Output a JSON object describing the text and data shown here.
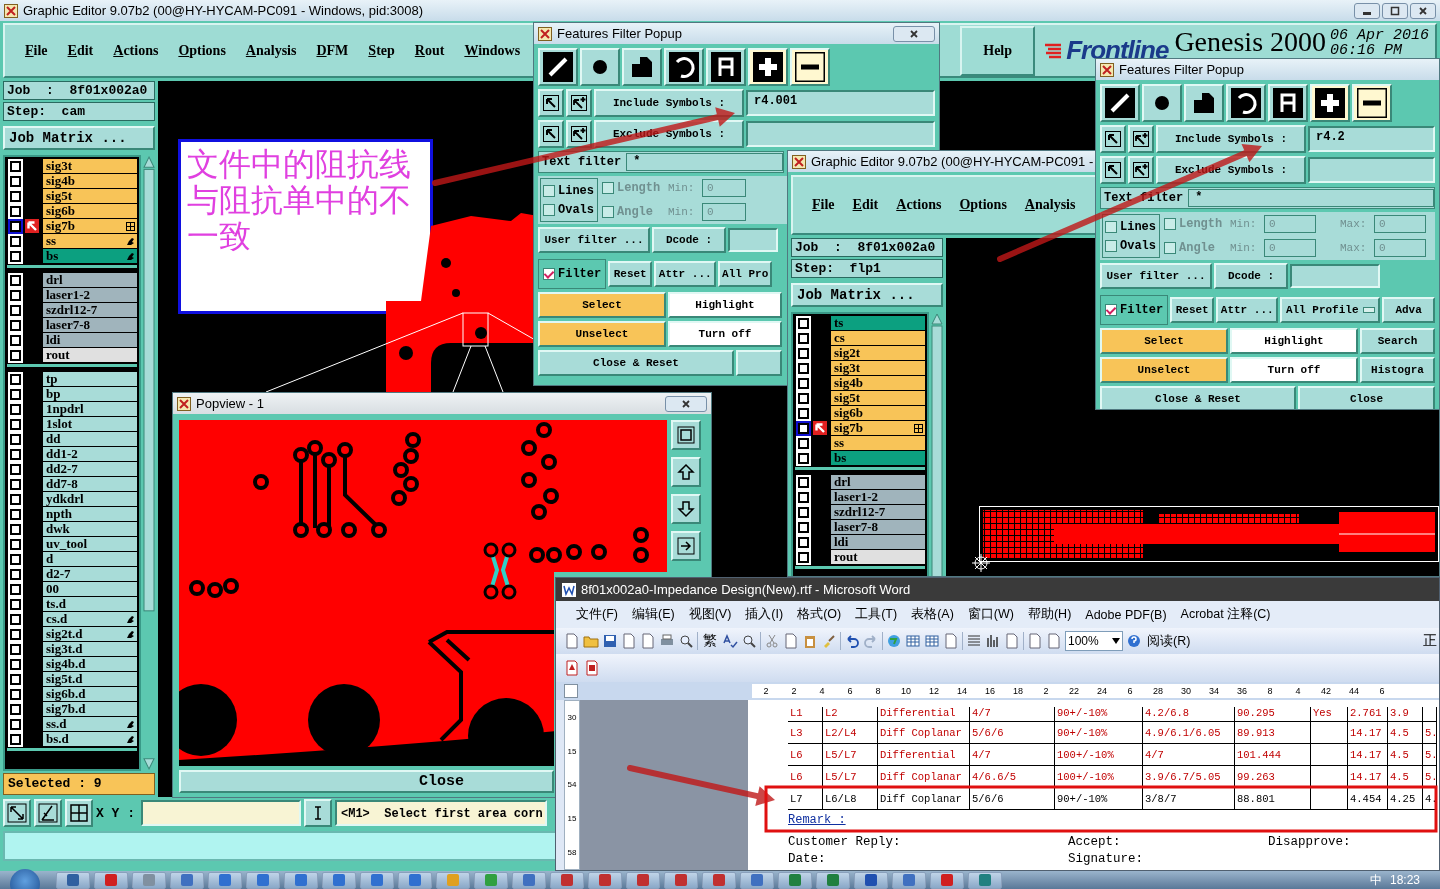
{
  "main_window": {
    "title": "Graphic Editor 9.07b2 (00@HY-HYCAM-PC091 - Windows, pid:3008)",
    "menu": [
      "File",
      "Edit",
      "Actions",
      "Options",
      "Analysis",
      "DFM",
      "Step",
      "Rout",
      "Windows"
    ],
    "help": "Help",
    "logo": "Frontline",
    "product": "Genesis 2000",
    "date": "06 Apr 2016",
    "time": "06:16 PM",
    "job": "Job  :  8f01x002a0",
    "step": "Step:  cam",
    "job_matrix": "Job Matrix ...",
    "layer_groups": [
      {
        "layers": [
          {
            "name": "sig3t",
            "color": "#f8c458",
            "checked": false,
            "work": false,
            "kind": "plain"
          },
          {
            "name": "sig4b",
            "color": "#f8c458",
            "checked": false,
            "work": false,
            "kind": "plain"
          },
          {
            "name": "sig5t",
            "color": "#f8c458",
            "checked": false,
            "work": false,
            "kind": "plain"
          },
          {
            "name": "sig6b",
            "color": "#f8c458",
            "checked": false,
            "work": false,
            "kind": "plain"
          },
          {
            "name": "sig7b",
            "color": "#f8c458",
            "checked": false,
            "work": true,
            "kind": "grid"
          },
          {
            "name": "ss",
            "color": "#f8c458",
            "checked": false,
            "work": false,
            "kind": "hand"
          },
          {
            "name": "bs",
            "color": "#0ca080",
            "checked": false,
            "work": false,
            "kind": "hand"
          }
        ]
      },
      {
        "layers": [
          {
            "name": "drl",
            "color": "#a0b4bc",
            "checked": false,
            "work": false,
            "kind": "plain"
          },
          {
            "name": "laser1-2",
            "color": "#a0b4bc",
            "checked": false,
            "work": false,
            "kind": "plain"
          },
          {
            "name": "szdrl12-7",
            "color": "#a0b4bc",
            "checked": false,
            "work": false,
            "kind": "plain"
          },
          {
            "name": "laser7-8",
            "color": "#a0b4bc",
            "checked": false,
            "work": false,
            "kind": "plain"
          },
          {
            "name": "ldi",
            "color": "#a0b4bc",
            "checked": false,
            "work": false,
            "kind": "plain"
          },
          {
            "name": "rout",
            "color": "#e0e0e0",
            "checked": false,
            "work": false,
            "kind": "plain"
          }
        ]
      },
      {
        "layers": [
          {
            "name": "tp",
            "color": "#a8dcd8",
            "checked": false,
            "work": false,
            "kind": "plain"
          },
          {
            "name": "bp",
            "color": "#a8dcd8",
            "checked": false,
            "work": false,
            "kind": "plain"
          },
          {
            "name": "1npdrl",
            "color": "#a8dcd8",
            "checked": false,
            "work": false,
            "kind": "plain"
          },
          {
            "name": "1slot",
            "color": "#a8dcd8",
            "checked": false,
            "work": false,
            "kind": "plain"
          },
          {
            "name": "dd",
            "color": "#a8dcd8",
            "checked": false,
            "work": false,
            "kind": "plain"
          },
          {
            "name": "dd1-2",
            "color": "#a8dcd8",
            "checked": false,
            "work": false,
            "kind": "plain"
          },
          {
            "name": "dd2-7",
            "color": "#a8dcd8",
            "checked": false,
            "work": false,
            "kind": "plain"
          },
          {
            "name": "dd7-8",
            "color": "#a8dcd8",
            "checked": false,
            "work": false,
            "kind": "plain"
          },
          {
            "name": "ydkdrl",
            "color": "#a8dcd8",
            "checked": false,
            "work": false,
            "kind": "plain"
          },
          {
            "name": "npth",
            "color": "#a8dcd8",
            "checked": false,
            "work": false,
            "kind": "plain"
          },
          {
            "name": "dwk",
            "color": "#a8dcd8",
            "checked": false,
            "work": false,
            "kind": "plain"
          },
          {
            "name": "uv_tool",
            "color": "#a8dcd8",
            "checked": false,
            "work": false,
            "kind": "plain"
          },
          {
            "name": "d",
            "color": "#a8dcd8",
            "checked": false,
            "work": false,
            "kind": "plain"
          },
          {
            "name": "d2-7",
            "color": "#a8dcd8",
            "checked": false,
            "work": false,
            "kind": "plain"
          },
          {
            "name": "00",
            "color": "#a8dcd8",
            "checked": false,
            "work": false,
            "kind": "plain"
          },
          {
            "name": "ts.d",
            "color": "#a8dcd8",
            "checked": false,
            "work": false,
            "kind": "plain"
          },
          {
            "name": "cs.d",
            "color": "#a8dcd8",
            "checked": false,
            "work": false,
            "kind": "hand"
          },
          {
            "name": "sig2t.d",
            "color": "#a8dcd8",
            "checked": false,
            "work": false,
            "kind": "hand"
          },
          {
            "name": "sig3t.d",
            "color": "#a8dcd8",
            "checked": false,
            "work": false,
            "kind": "plain"
          },
          {
            "name": "sig4b.d",
            "color": "#a8dcd8",
            "checked": false,
            "work": false,
            "kind": "plain"
          },
          {
            "name": "sig5t.d",
            "color": "#a8dcd8",
            "checked": false,
            "work": false,
            "kind": "plain"
          },
          {
            "name": "sig6b.d",
            "color": "#a8dcd8",
            "checked": false,
            "work": false,
            "kind": "plain"
          },
          {
            "name": "sig7b.d",
            "color": "#a8dcd8",
            "checked": false,
            "work": false,
            "kind": "plain"
          },
          {
            "name": "ss.d",
            "color": "#a8dcd8",
            "checked": false,
            "work": false,
            "kind": "hand"
          },
          {
            "name": "bs.d",
            "color": "#a8dcd8",
            "checked": false,
            "work": false,
            "kind": "hand"
          }
        ]
      }
    ],
    "selected_count": "Selected : 9",
    "xy_label": "X Y :",
    "prompt": "<M1>  Select first area corn",
    "note": "文件中的阻抗线与阻抗单中的不一致"
  },
  "filter_popup_1": {
    "title": "Features Filter Popup",
    "tools": [
      {
        "kind": "line",
        "on": false
      },
      {
        "kind": "pad",
        "on": false
      },
      {
        "kind": "surface",
        "on": false
      },
      {
        "kind": "arc",
        "on": false
      },
      {
        "kind": "text",
        "on": false
      },
      {
        "kind": "positive",
        "on": true
      },
      {
        "kind": "negative",
        "on": true
      }
    ],
    "include_label": "Include Symbols :",
    "include_value": "r4.001",
    "exclude_label": "Exclude Symbols :",
    "text_filter_label": "Text filter",
    "text_filter_value": "*",
    "types": [
      {
        "label": "Lines",
        "checked": false
      },
      {
        "label": "Ovals",
        "checked": false
      }
    ],
    "ranges": [
      {
        "label": "Length",
        "checked": false,
        "disabled": true,
        "min_label": "Min:",
        "min": "0"
      },
      {
        "label": "Angle",
        "checked": false,
        "disabled": true,
        "min_label": "Min:",
        "min": "0"
      }
    ],
    "user_filter": "User filter ...",
    "dcode": "Dcode :",
    "filter": {
      "label": "Filter",
      "checked": true
    },
    "reset": "Reset",
    "attr": "Attr ...",
    "profile": "All Pro",
    "select": "Select",
    "highlight": "Highlight",
    "unselect": "Unselect",
    "turn_off": "Turn off",
    "close_reset": "Close & Reset"
  },
  "graphic_editor_2": {
    "title": "Graphic Editor 9.07b2 (00@HY-HYCAM-PC091 -",
    "menu": [
      "File",
      "Edit",
      "Actions",
      "Options",
      "Analysis"
    ],
    "job": "Job  :  8f01x002a0",
    "step": "Step:  flp1",
    "job_matrix": "Job Matrix ...",
    "layer_groups": [
      {
        "layers": [
          {
            "name": "ts",
            "color": "#0ca080",
            "checked": false,
            "work": false,
            "kind": "plain"
          },
          {
            "name": "cs",
            "color": "#f8c458",
            "checked": false,
            "work": false,
            "kind": "plain"
          },
          {
            "name": "sig2t",
            "color": "#f8c458",
            "checked": false,
            "work": false,
            "kind": "plain"
          },
          {
            "name": "sig3t",
            "color": "#f8c458",
            "checked": false,
            "work": false,
            "kind": "plain"
          },
          {
            "name": "sig4b",
            "color": "#f8c458",
            "checked": false,
            "work": false,
            "kind": "plain"
          },
          {
            "name": "sig5t",
            "color": "#f8c458",
            "checked": false,
            "work": false,
            "kind": "plain"
          },
          {
            "name": "sig6b",
            "color": "#f8c458",
            "checked": false,
            "work": false,
            "kind": "plain"
          },
          {
            "name": "sig7b",
            "color": "#f8c458",
            "checked": false,
            "work": true,
            "kind": "grid"
          },
          {
            "name": "ss",
            "color": "#f8c458",
            "checked": false,
            "work": false,
            "kind": "plain"
          },
          {
            "name": "bs",
            "color": "#0ca080",
            "checked": false,
            "work": false,
            "kind": "plain"
          }
        ]
      },
      {
        "layers": [
          {
            "name": "drl",
            "color": "#a0b4bc",
            "checked": false,
            "work": false,
            "kind": "plain"
          },
          {
            "name": "laser1-2",
            "color": "#a0b4bc",
            "checked": false,
            "work": false,
            "kind": "plain"
          },
          {
            "name": "szdrl12-7",
            "color": "#a0b4bc",
            "checked": false,
            "work": false,
            "kind": "plain"
          },
          {
            "name": "laser7-8",
            "color": "#a0b4bc",
            "checked": false,
            "work": false,
            "kind": "plain"
          },
          {
            "name": "ldi",
            "color": "#a0b4bc",
            "checked": false,
            "work": false,
            "kind": "plain"
          },
          {
            "name": "rout",
            "color": "#e0e0e0",
            "checked": false,
            "work": false,
            "kind": "plain"
          }
        ]
      }
    ]
  },
  "filter_popup_2": {
    "title": "Features Filter Popup",
    "tools": [
      {
        "kind": "line",
        "on": false
      },
      {
        "kind": "pad",
        "on": false
      },
      {
        "kind": "surface",
        "on": false
      },
      {
        "kind": "arc",
        "on": false
      },
      {
        "kind": "text",
        "on": false
      },
      {
        "kind": "positive",
        "on": true
      },
      {
        "kind": "negative",
        "on": true
      }
    ],
    "include_label": "Include Symbols :",
    "include_value": "r4.2",
    "exclude_label": "Exclude Symbols :",
    "text_filter_label": "Text filter",
    "text_filter_value": "*",
    "types": [
      {
        "label": "Lines",
        "checked": false
      },
      {
        "label": "Ovals",
        "checked": false
      }
    ],
    "ranges": [
      {
        "label": "Length",
        "checked": false,
        "disabled": true,
        "min_label": "Min:",
        "min": "0",
        "max_label": "Max:",
        "max": "0"
      },
      {
        "label": "Angle",
        "checked": false,
        "disabled": true,
        "min_label": "Min:",
        "min": "0",
        "max_label": "Max:",
        "max": "0"
      }
    ],
    "user_filter": "User filter ...",
    "dcode": "Dcode :",
    "filter": {
      "label": "Filter",
      "checked": true
    },
    "reset": "Reset",
    "attr": "Attr ...",
    "profile": "All Profile",
    "advanced": "Adva",
    "select": "Select",
    "highlight": "Highlight",
    "search": "Search",
    "unselect": "Unselect",
    "turn_off": "Turn off",
    "histogram": "Histogra",
    "close_reset": "Close & Reset",
    "close": "Close"
  },
  "popview": {
    "title": "Popview - 1",
    "close": "Close"
  },
  "word_window": {
    "title": "8f01x002a0-Impedance Design(New).rtf - Microsoft Word",
    "menu": [
      "文件(F)",
      "编辑(E)",
      "视图(V)",
      "插入(I)",
      "格式(O)",
      "工具(T)",
      "表格(A)",
      "窗口(W)",
      "帮助(H)",
      "Adobe PDF(B)",
      "Acrobat 注释(C)"
    ],
    "traditional": "繁",
    "zoom": "100%",
    "reading": "阅读(R)",
    "style_cut": "正",
    "ruler": [
      "2",
      "2",
      "4",
      "6",
      "8",
      "10",
      "12",
      "14",
      "16",
      "18",
      "2",
      "22",
      "24",
      "6",
      "28",
      "30",
      "34",
      "36",
      "8",
      "4",
      "42",
      "44",
      "6"
    ],
    "vruler": [
      "30",
      "15",
      "54",
      "15",
      "58"
    ],
    "rows": [
      {
        "emphasis": true,
        "cells": [
          "L1",
          "L2",
          "Differential",
          "4/7",
          "90+/-10%",
          "4.2/6.8",
          "90.295",
          "Yes",
          "2.761",
          "3.9",
          ""
        ]
      },
      {
        "emphasis": true,
        "cells": [
          "L3",
          "L2/L4",
          "Diff Coplanar",
          "5/6/6",
          "90+/-10%",
          "4.9/6.1/6.05",
          "89.913",
          "",
          "14.17",
          "4.5",
          "5."
        ]
      },
      {
        "emphasis": true,
        "cells": [
          "L6",
          "L5/L7",
          "Differential",
          "4/7",
          "100+/-10%",
          "4/7",
          "101.444",
          "",
          "14.17",
          "4.5",
          "5."
        ]
      },
      {
        "emphasis": true,
        "cells": [
          "L6",
          "L5/L7",
          "Diff Coplanar",
          "4/6.6/5",
          "100+/-10%",
          "3.9/6.7/5.05",
          "99.263",
          "",
          "14.17",
          "4.5",
          "5."
        ]
      },
      {
        "emphasis": false,
        "cells": [
          "L7",
          "L6/L8",
          "Diff Coplanar",
          "5/6/6",
          "90+/-10%",
          "3/8/7",
          "88.801",
          "",
          "4.454",
          "4.25",
          "4."
        ]
      }
    ],
    "remark": "Remark :",
    "reply": "Customer Reply:",
    "accept": "Accept:",
    "disapprove": "Disapprove:",
    "date": "Date:",
    "signature": "Signature:"
  },
  "taskbar": {
    "apps": [
      {
        "kind": "disk"
      },
      {
        "kind": "g"
      },
      {
        "kind": "calc"
      },
      {
        "kind": "doc"
      },
      {
        "kind": "f"
      },
      {
        "kind": "f"
      },
      {
        "kind": "f"
      },
      {
        "kind": "f"
      },
      {
        "kind": "f"
      },
      {
        "kind": "f"
      },
      {
        "kind": "star"
      },
      {
        "kind": "arrow"
      },
      {
        "kind": "doc"
      },
      {
        "kind": "x"
      },
      {
        "kind": "x"
      },
      {
        "kind": "x"
      },
      {
        "kind": "x"
      },
      {
        "kind": "x"
      },
      {
        "kind": "doc"
      },
      {
        "kind": "excel"
      },
      {
        "kind": "excel"
      },
      {
        "kind": "word"
      },
      {
        "kind": "doc"
      },
      {
        "kind": "pdf"
      },
      {
        "kind": "eye"
      }
    ],
    "ime": "中",
    "clock": "18:23"
  }
}
